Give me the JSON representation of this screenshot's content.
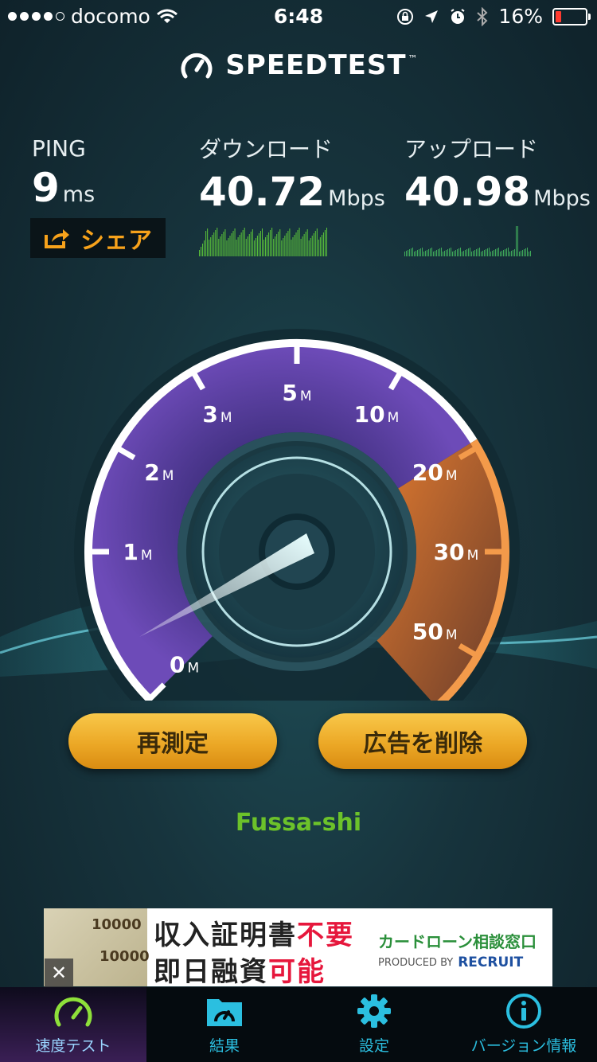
{
  "status_bar": {
    "carrier": "docomo",
    "time": "6:48",
    "battery": "16%"
  },
  "app": {
    "title": "SPEEDTEST",
    "trademark": "™"
  },
  "stats": {
    "ping": {
      "label": "PING",
      "value": "9",
      "unit": "ms"
    },
    "download": {
      "label": "ダウンロード",
      "value": "40.72",
      "unit": "Mbps"
    },
    "upload": {
      "label": "アップロード",
      "value": "40.98",
      "unit": "Mbps"
    }
  },
  "share_label": "シェア",
  "gauge": {
    "ticks": [
      {
        "num": "0",
        "unit": "M"
      },
      {
        "num": "1",
        "unit": "M"
      },
      {
        "num": "2",
        "unit": "M"
      },
      {
        "num": "3",
        "unit": "M"
      },
      {
        "num": "5",
        "unit": "M"
      },
      {
        "num": "10",
        "unit": "M"
      },
      {
        "num": "20",
        "unit": "M"
      },
      {
        "num": "30",
        "unit": "M"
      },
      {
        "num": "50",
        "unit": "M"
      }
    ]
  },
  "buttons": {
    "retest": "再測定",
    "remove_ads": "広告を削除"
  },
  "location": "Fussa-shi",
  "ad": {
    "line1a": "収入証明書",
    "line1b": "不要",
    "line2a": "即日融資",
    "line2b": "可能",
    "brand": "カードローン相談窓口",
    "produced": "PRODUCED BY",
    "recruit": "RECRUIT",
    "bill_numbers": [
      "10000",
      "10000"
    ],
    "close": "✕"
  },
  "tabs": [
    {
      "label": "速度テスト",
      "icon": "speedometer-icon"
    },
    {
      "label": "結果",
      "icon": "results-folder-icon"
    },
    {
      "label": "設定",
      "icon": "gear-icon"
    },
    {
      "label": "バージョン情報",
      "icon": "info-icon"
    }
  ],
  "colors": {
    "accent_orange": "#f7a21b",
    "location_green": "#6cc22a",
    "tab_blue": "#2bbfe0"
  }
}
